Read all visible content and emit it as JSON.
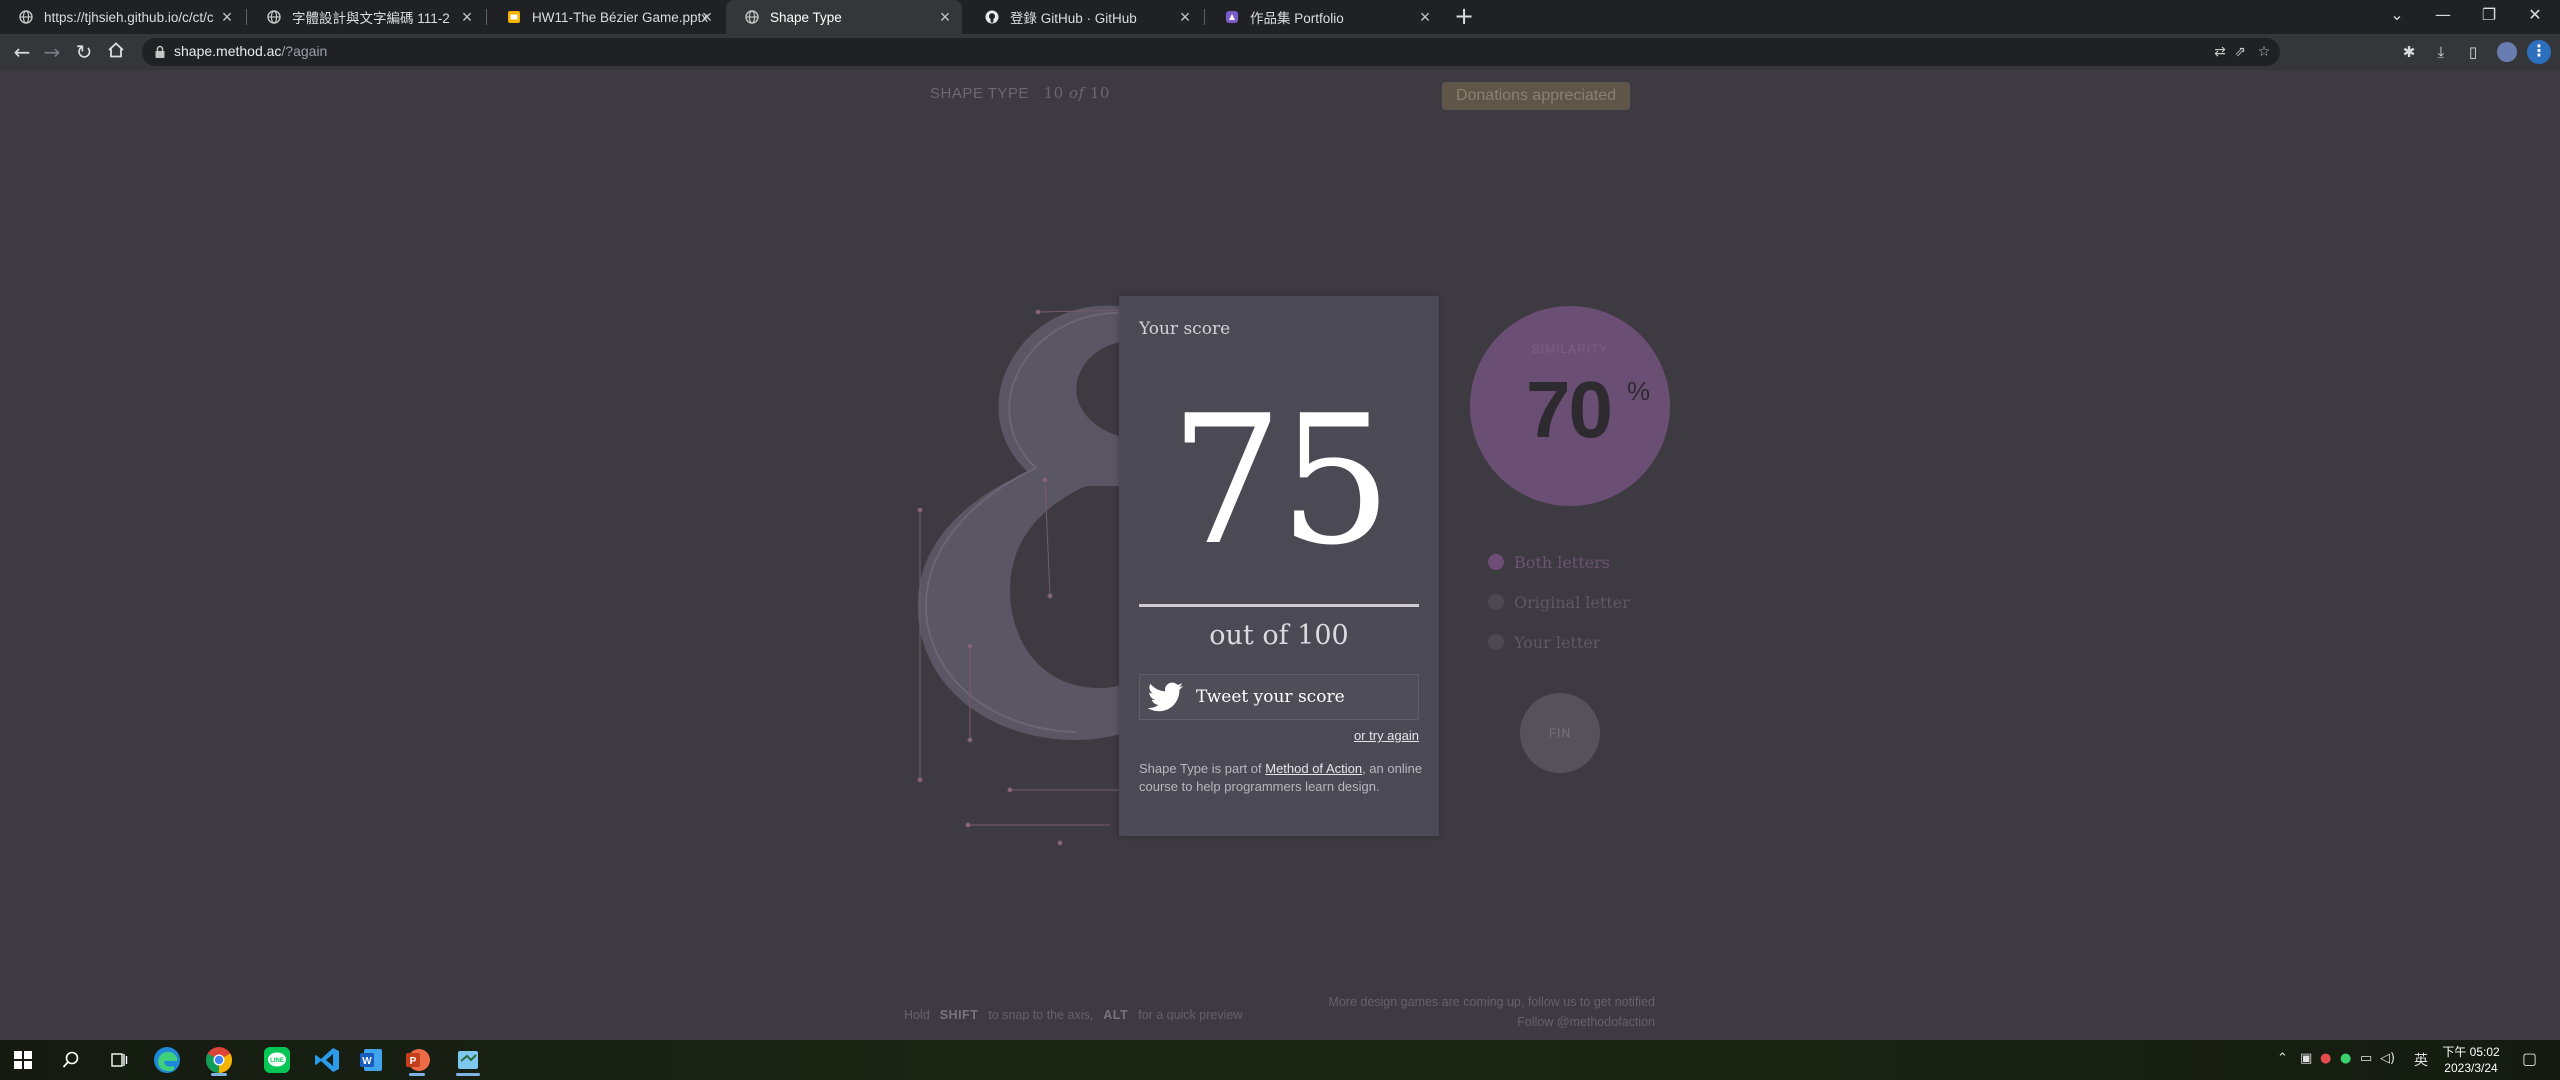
{
  "browser": {
    "tabs": [
      {
        "title": "https://tjhsieh.github.io/c/ct/c",
        "icon": "globe-icon"
      },
      {
        "title": "字體設計與文字編碼 111-2",
        "icon": "globe-icon"
      },
      {
        "title": "HW11-The Bézier Game.pptx -",
        "icon": "slides-icon"
      },
      {
        "title": "Shape Type",
        "icon": "globe-icon",
        "active": true
      },
      {
        "title": "登錄 GitHub · GitHub",
        "icon": "github-icon"
      },
      {
        "title": "作品集 Portfolio",
        "icon": "portfolio-icon"
      }
    ],
    "url_host": "shape.method.ac",
    "url_path": "/?again"
  },
  "page": {
    "header": {
      "label": "SHAPE TYPE",
      "current": "10",
      "of": "of",
      "total": "10"
    },
    "donate_label": "Donations appreciated",
    "similarity": {
      "label": "SIMILARITY",
      "value": "70",
      "unit": "%"
    },
    "view_options": [
      {
        "label": "Both letters",
        "selected": true
      },
      {
        "label": "Original letter",
        "selected": false
      },
      {
        "label": "Your letter",
        "selected": false
      }
    ],
    "fin_label": "FIN",
    "footer_hint": {
      "prefix": "Hold",
      "key1": "SHIFT",
      "mid": "to snap to the axis,",
      "key2": "ALT",
      "suffix": "for a quick preview"
    },
    "footer_right": {
      "line1": "More design games are coming up, follow us to get notified",
      "line2": "Follow @methodofaction"
    },
    "glyph": "&"
  },
  "modal": {
    "title": "Your score",
    "score": "75",
    "out_of": "out of 100",
    "tweet_label": "Tweet your score",
    "try_again": "or try again",
    "about_prefix": "Shape Type is part of ",
    "about_link": "Method of Action",
    "about_suffix": ", an online course to help programmers learn design."
  },
  "taskbar": {
    "apps": [
      "windows-start-icon",
      "search-icon",
      "task-view-icon",
      "edge-icon",
      "chrome-icon",
      "line-icon",
      "vscode-icon",
      "word-icon",
      "powerpoint-icon",
      "notepad-icon"
    ],
    "ime": "英",
    "time": "下午 05:02",
    "date": "2023/3/24"
  },
  "colors": {
    "accent": "#6b4e73",
    "modal_bg": "#4b4a54",
    "page_bg": "#3e3a41"
  }
}
